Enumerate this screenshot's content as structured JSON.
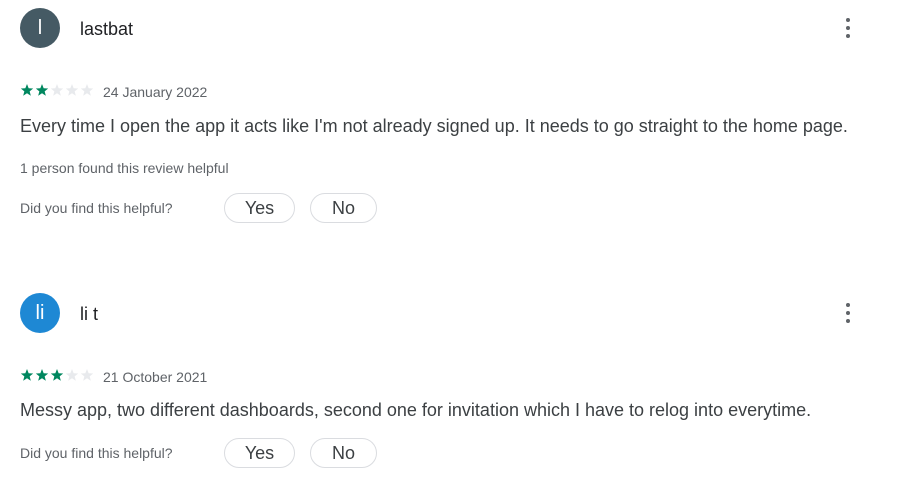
{
  "colors": {
    "star_filled": "#01875f",
    "star_empty": "#e8eaed",
    "avatar_review1": "#455a64",
    "avatar_review2": "#1e88d4"
  },
  "reviews": [
    {
      "avatar_letter": "l",
      "username": "lastbat",
      "rating": 2,
      "max_rating": 5,
      "date": "24 January 2022",
      "text": "Every time I open the app it acts like I'm not already signed up. It needs to go straight to the home page.",
      "helpful_count_text": "1 person found this review helpful",
      "helpful_question": "Did you find this helpful?",
      "yes_label": "Yes",
      "no_label": "No",
      "more_icon": "more-vert-icon"
    },
    {
      "avatar_letter": "li",
      "username": "li t",
      "rating": 3,
      "max_rating": 5,
      "date": "21 October 2021",
      "text": "Messy app, two different dashboards, second one for invitation which I have to relog into everytime.",
      "helpful_question": "Did you find this helpful?",
      "yes_label": "Yes",
      "no_label": "No",
      "more_icon": "more-vert-icon"
    }
  ]
}
